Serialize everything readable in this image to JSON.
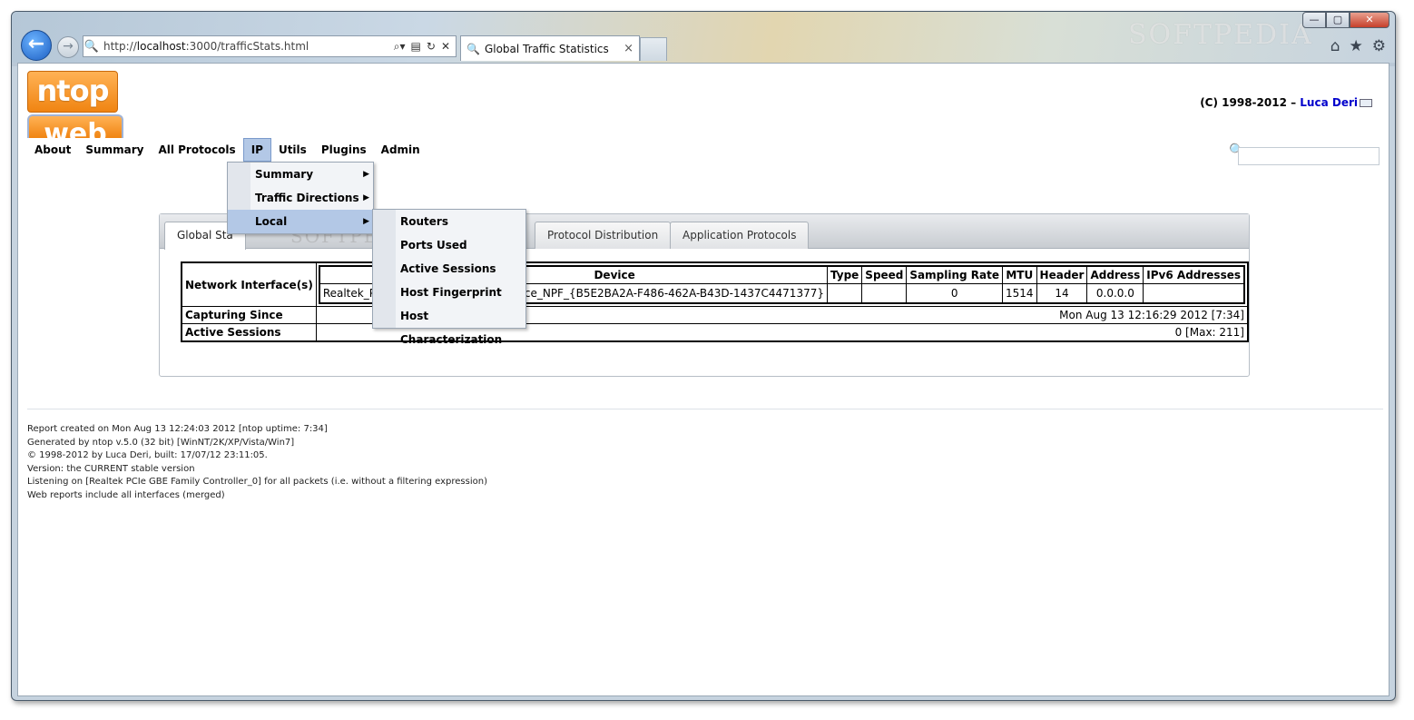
{
  "browser": {
    "url_prefix": "http://",
    "url_host": "localhost",
    "url_rest": ":3000/trafficStats.html",
    "tab_title": "Global Traffic Statistics",
    "tab_close": "×",
    "watermark": "SOFTPEDIA",
    "window_buttons": {
      "minimize": "—",
      "maximize": "▢",
      "close": "✕"
    },
    "icons": {
      "back": "back-arrow-icon",
      "forward": "forward-arrow-icon",
      "search": "magnifier-icon",
      "refresh": "refresh-icon",
      "stop": "stop-icon",
      "compat": "compatibility-view-icon",
      "home": "home-icon",
      "favorites": "star-icon",
      "tools": "gear-icon"
    }
  },
  "header": {
    "logo_text": "ntop",
    "logo2_text": "web",
    "copyright_prefix": "(C) 1998-2012 – ",
    "copyright_author": "Luca Deri"
  },
  "menubar": {
    "items": [
      "About",
      "Summary",
      "All Protocols",
      "IP",
      "Utils",
      "Plugins",
      "Admin"
    ]
  },
  "ip_menu": {
    "items": [
      "Summary",
      "Traffic Directions",
      "Local"
    ]
  },
  "local_submenu": {
    "items": [
      "Routers",
      "Ports Used",
      "Active Sessions",
      "Host Fingerprint",
      "Host Characterization"
    ]
  },
  "panel": {
    "tabs": [
      "Global Sta",
      "Protocol Distribution",
      "Application Protocols"
    ],
    "watermark": "SOFTPEDIA",
    "rows": {
      "network_interfaces": "Network Interface(s)",
      "capturing_since": "Capturing Since",
      "active_sessions": "Active Sessions"
    },
    "iface_headers": [
      "",
      "Device",
      "Type",
      "Speed",
      "Sampling Rate",
      "MTU",
      "Header",
      "Address",
      "IPv6 Addresses"
    ],
    "iface_row": [
      "Realtek_PCIe_",
      "_Device_NPF_{B5E2BA2A-F486-462A-B43D-1437C4471377}",
      "",
      "",
      "0",
      "1514",
      "14",
      "0.0.0.0",
      ""
    ],
    "capturing_since_value": "Mon Aug 13 12:16:29 2012 [7:34]",
    "active_sessions_value": "0 [Max: 211]"
  },
  "footer": {
    "lines": [
      "Report created on Mon Aug 13 12:24:03 2012 [ntop uptime: 7:34]",
      "Generated by ntop v.5.0 (32 bit) [WinNT/2K/XP/Vista/Win7]",
      "© 1998-2012 by Luca Deri, built: 17/07/12 23:11:05.",
      "Version: the CURRENT stable version",
      "Listening on [Realtek PCIe GBE Family Controller_0] for all packets (i.e. without a filtering expression)",
      "Web reports include all interfaces (merged)"
    ]
  }
}
